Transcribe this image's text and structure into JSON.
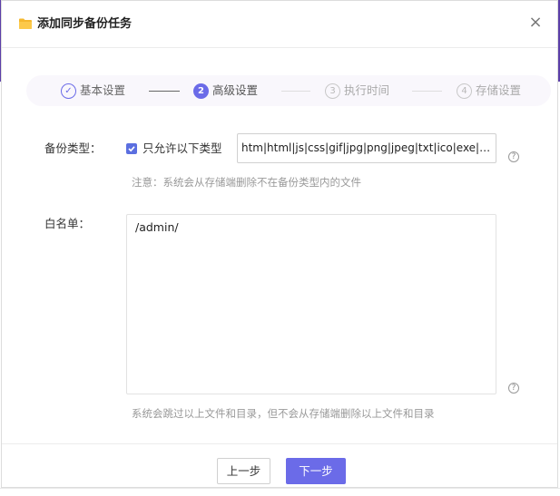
{
  "dialog": {
    "title": "添加同步备份任务",
    "close_glyph": "×"
  },
  "steps": [
    {
      "number": "✓",
      "label": "基本设置",
      "state": "done"
    },
    {
      "number": "2",
      "label": "高级设置",
      "state": "active"
    },
    {
      "number": "3",
      "label": "执行时间",
      "state": "pending"
    },
    {
      "number": "4",
      "label": "存储设置",
      "state": "pending"
    }
  ],
  "form": {
    "backup_type_label": "备份类型：",
    "only_allow_label": "只允许以下类型",
    "only_allow_checked": true,
    "types_value": "htm|html|js|css|gif|jpg|png|jpeg|txt|ico|exe|zip|rar",
    "types_note": "注意：系统会从存储端删除不在备份类型内的文件",
    "whitelist_label": "白名单：",
    "whitelist_value": "/admin/",
    "whitelist_note": "系统会跳过以上文件和目录，但不会从存储端删除以上文件和目录",
    "help_glyph": "?"
  },
  "footer": {
    "prev_label": "上一步",
    "next_label": "下一步"
  },
  "colors": {
    "accent": "#6b6be8",
    "folder": "#f5b82e",
    "background_bar": "#5b3fa8"
  }
}
